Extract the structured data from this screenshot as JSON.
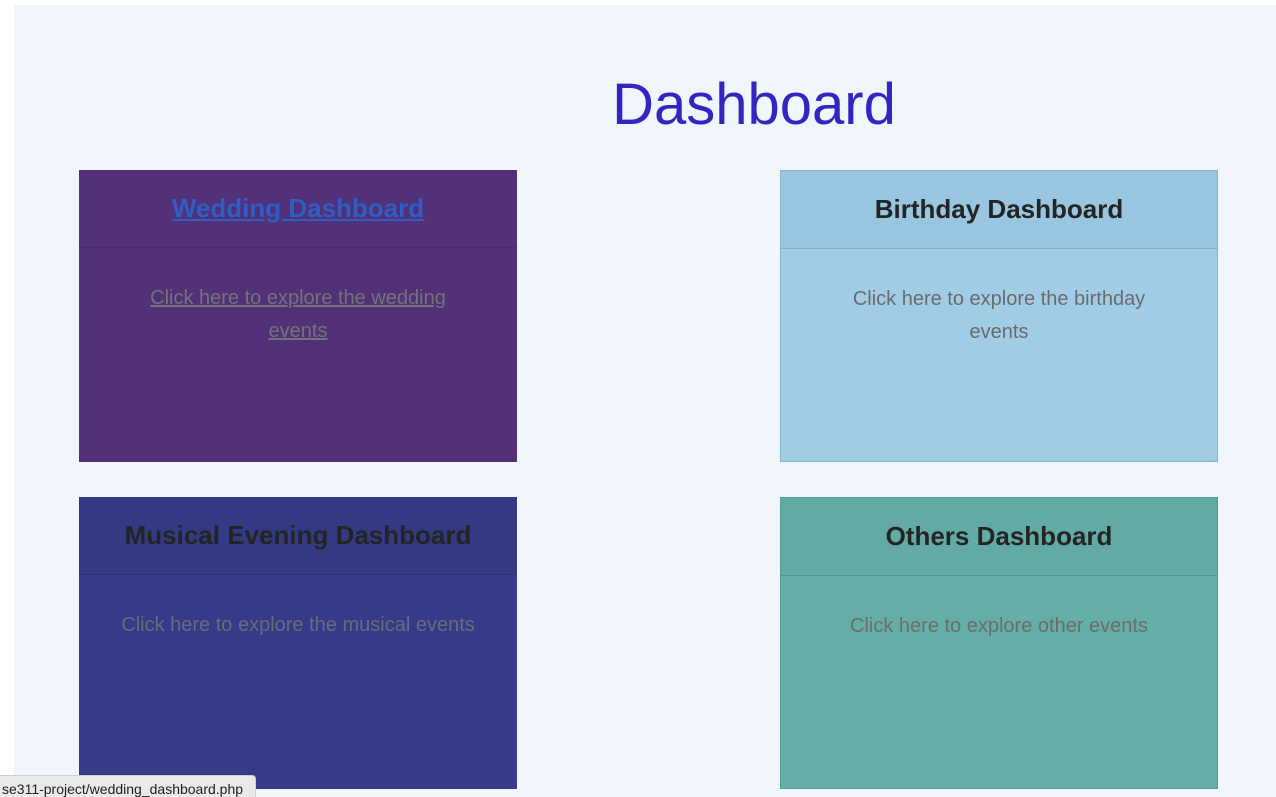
{
  "page": {
    "title": "Dashboard"
  },
  "cards": [
    {
      "title": "Wedding Dashboard",
      "body": "Click here to explore the wedding events",
      "color": "#523178"
    },
    {
      "title": "Birthday Dashboard",
      "body": "Click here to explore the birthday events",
      "color": "#a0cce6"
    },
    {
      "title": "Musical Evening Dashboard",
      "body": "Click here to explore the musical events",
      "color": "#353a89"
    },
    {
      "title": "Others Dashboard",
      "body": "Click here to explore other events",
      "color": "#63aea6"
    }
  ],
  "status_bar": {
    "url": "se311-project/wedding_dashboard.php"
  },
  "colors": {
    "page_background": "#f1f6fd",
    "title": "#3325c2",
    "link": "#2f5fc4"
  }
}
